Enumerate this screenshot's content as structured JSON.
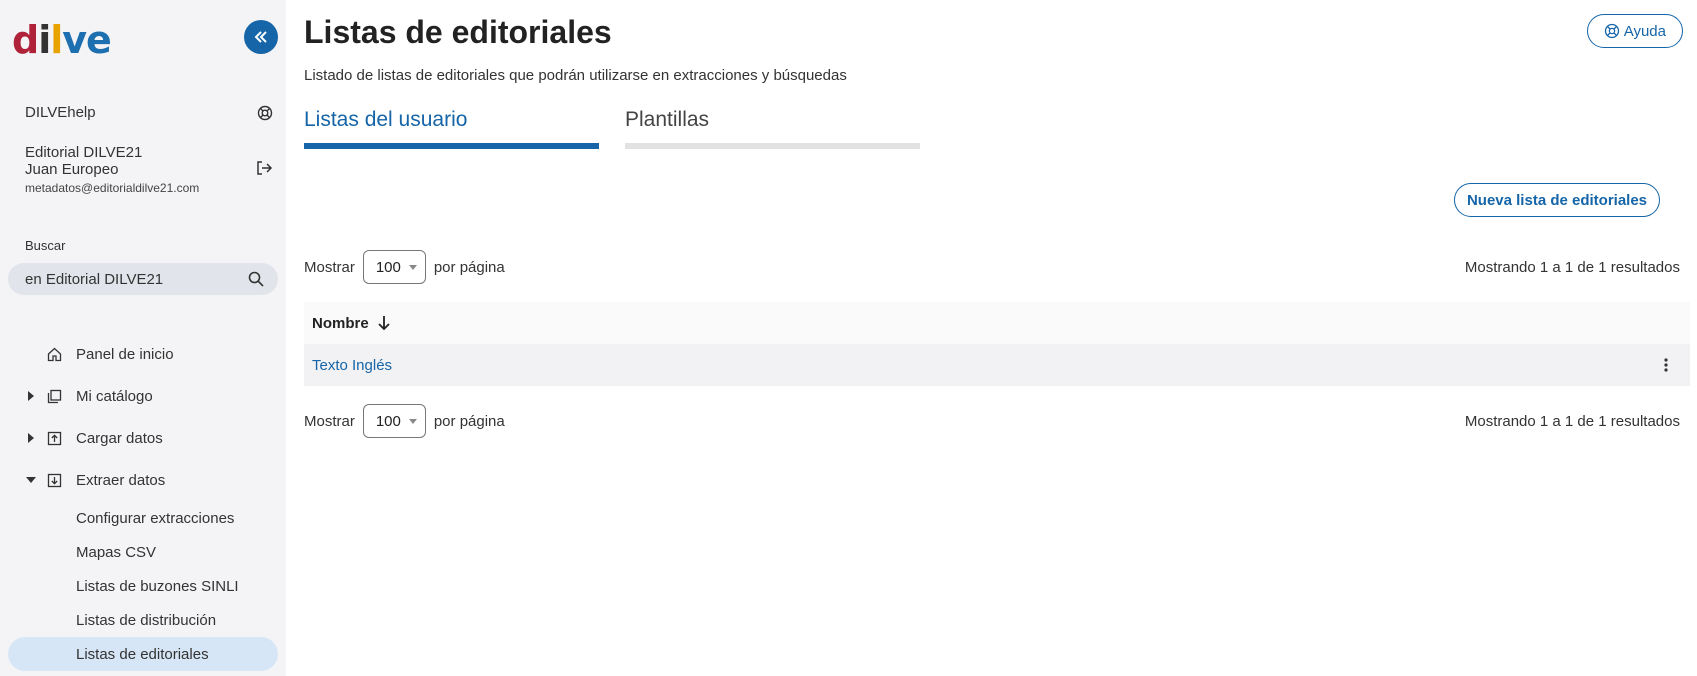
{
  "brand": {
    "logo": [
      "d",
      "i",
      "l",
      "ve"
    ],
    "accent": "#1565a8"
  },
  "sidebar": {
    "help_label": "DILVEhelp",
    "org": "Editorial DILVE21",
    "user_name": "Juan Europeo",
    "email": "metadatos@editorialdilve21.com",
    "search_label": "Buscar",
    "search_value": "en Editorial DILVE21",
    "nav": [
      {
        "label": "Panel de inicio",
        "icon": "home-icon"
      },
      {
        "label": "Mi catálogo",
        "icon": "catalog-icon"
      },
      {
        "label": "Cargar datos",
        "icon": "upload-icon"
      },
      {
        "label": "Extraer datos",
        "icon": "download-icon"
      }
    ],
    "sub_items": [
      "Configurar extracciones",
      "Mapas CSV",
      "Listas de buzones SINLI",
      "Listas de distribución",
      "Listas de editoriales"
    ]
  },
  "main": {
    "title": "Listas de editoriales",
    "help_button": "Ayuda",
    "subtitle": "Listado de listas de editoriales que podrán utilizarse en extracciones y búsquedas",
    "tabs": [
      "Listas del usuario",
      "Plantillas"
    ],
    "new_button": "Nueva lista de editoriales",
    "pager": {
      "show_label": "Mostrar",
      "per_page_value": "100",
      "per_page_label": "por página",
      "results": "Mostrando 1 a 1 de 1 resultados"
    },
    "table": {
      "column": "Nombre",
      "rows": [
        "Texto Inglés"
      ]
    }
  }
}
